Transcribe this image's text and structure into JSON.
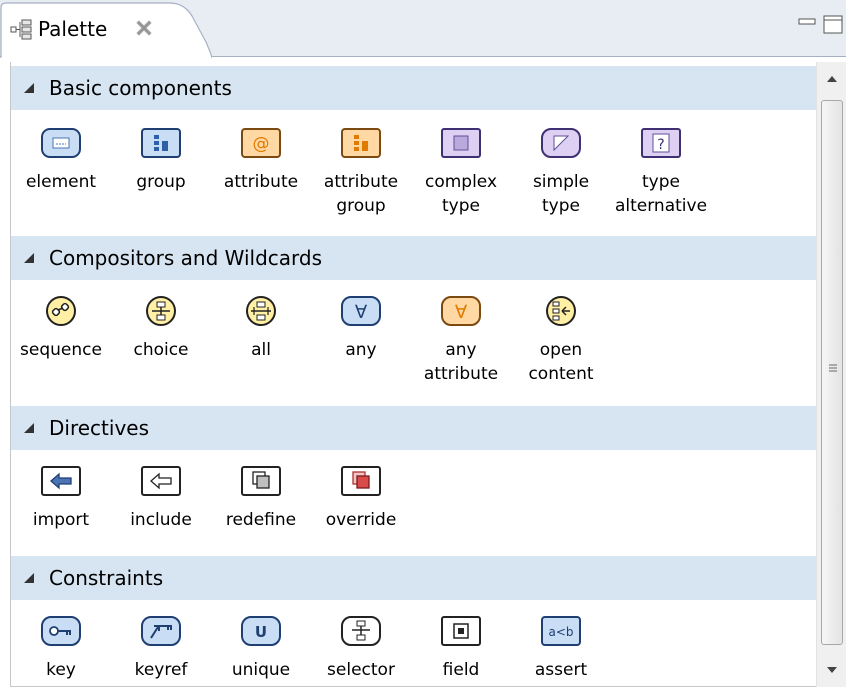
{
  "tab": {
    "title": "Palette",
    "icon": "palette-icon"
  },
  "drawers": [
    {
      "label": "Basic components",
      "tools": [
        {
          "label": "element",
          "icon": "element-icon"
        },
        {
          "label": "group",
          "icon": "group-icon"
        },
        {
          "label": "attribute",
          "icon": "attribute-icon"
        },
        {
          "label": "attribute\ngroup",
          "icon": "attribute-group-icon"
        },
        {
          "label": "complex\ntype",
          "icon": "complex-type-icon"
        },
        {
          "label": "simple\ntype",
          "icon": "simple-type-icon"
        },
        {
          "label": "type\nalternative",
          "icon": "type-alternative-icon"
        }
      ]
    },
    {
      "label": "Compositors and Wildcards",
      "tools": [
        {
          "label": "sequence",
          "icon": "sequence-icon"
        },
        {
          "label": "choice",
          "icon": "choice-icon"
        },
        {
          "label": "all",
          "icon": "all-icon"
        },
        {
          "label": "any",
          "icon": "any-icon"
        },
        {
          "label": "any\nattribute",
          "icon": "any-attribute-icon"
        },
        {
          "label": "open\ncontent",
          "icon": "open-content-icon"
        }
      ]
    },
    {
      "label": "Directives",
      "tools": [
        {
          "label": "import",
          "icon": "import-icon"
        },
        {
          "label": "include",
          "icon": "include-icon"
        },
        {
          "label": "redefine",
          "icon": "redefine-icon"
        },
        {
          "label": "override",
          "icon": "override-icon"
        }
      ]
    },
    {
      "label": "Constraints",
      "tools": [
        {
          "label": "key",
          "icon": "key-icon"
        },
        {
          "label": "keyref",
          "icon": "keyref-icon"
        },
        {
          "label": "unique",
          "icon": "unique-icon"
        },
        {
          "label": "selector",
          "icon": "selector-icon"
        },
        {
          "label": "field",
          "icon": "field-icon"
        },
        {
          "label": "assert",
          "icon": "assert-icon"
        }
      ]
    }
  ],
  "icon_text": {
    "attribute": "@",
    "any": "∀",
    "type_alternative": "?",
    "unique": "U",
    "assert": "a<b"
  },
  "colors": {
    "blue_fill": "#c9def5",
    "orange_fill": "#ffd8a3",
    "purple_fill": "#ddd0f3",
    "yellow_fill": "#fff0a6",
    "header_fill": "#d7e5f3"
  }
}
